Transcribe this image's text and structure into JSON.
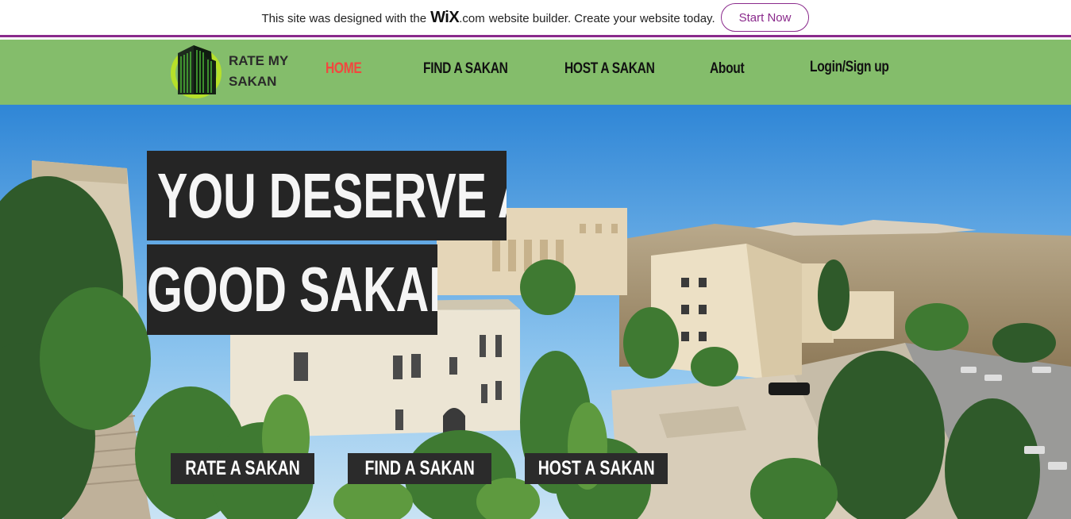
{
  "wix_banner": {
    "text_before": "This site was designed with the",
    "brand": "WiX",
    "brand_suffix": ".com",
    "text_after": "website builder. Create your website today.",
    "cta_label": "Start Now",
    "accent": "#8a2a8c"
  },
  "header": {
    "bg_color": "#84bd6b",
    "logo_line1": "RATE MY",
    "logo_line2": "SAKAN",
    "logo_icon": "building-logo-icon",
    "nav": [
      {
        "label": "HOME",
        "active": true
      },
      {
        "label": "FIND A SAKAN",
        "active": false
      },
      {
        "label": "HOST A SAKAN",
        "active": false
      },
      {
        "label": "About",
        "active": false
      },
      {
        "label": "Login/Sign up",
        "active": false
      }
    ],
    "active_color": "#f2473f"
  },
  "hero": {
    "headline_line1": "YOU DESERVE A",
    "headline_line2": "GOOD SAKAN",
    "buttons": [
      {
        "label": "RATE A SAKAN"
      },
      {
        "label": "FIND A SAKAN"
      },
      {
        "label": "HOST A SAKAN"
      }
    ]
  }
}
